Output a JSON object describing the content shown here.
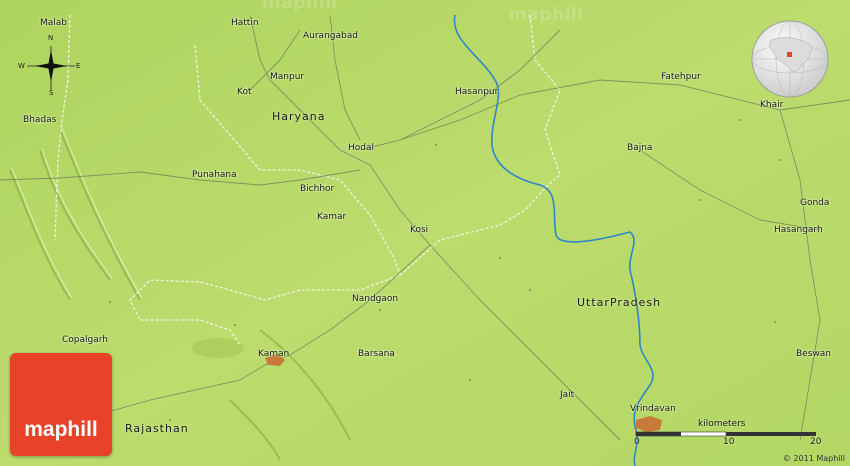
{
  "places": [
    {
      "name": "Malab"
    },
    {
      "name": "Hattin"
    },
    {
      "name": "Aurangabad"
    },
    {
      "name": "Manpur"
    },
    {
      "name": "Kot"
    },
    {
      "name": "Hasanpur"
    },
    {
      "name": "Fatehpur"
    },
    {
      "name": "Khair"
    },
    {
      "name": "Bhadas"
    },
    {
      "name": "Hodal"
    },
    {
      "name": "Bajna"
    },
    {
      "name": "Punahana"
    },
    {
      "name": "Bichhor"
    },
    {
      "name": "Kamar"
    },
    {
      "name": "Kosi"
    },
    {
      "name": "Gonda"
    },
    {
      "name": "Hasangarh"
    },
    {
      "name": "Nandgaon"
    },
    {
      "name": "Copalgarh"
    },
    {
      "name": "Kaman"
    },
    {
      "name": "Barsana"
    },
    {
      "name": "Beswan"
    },
    {
      "name": "Jait"
    },
    {
      "name": "Vrindavan"
    }
  ],
  "regions": {
    "haryana": "Haryana",
    "uttar_pradesh": "UttarPradesh",
    "rajasthan": "Rajasthan"
  },
  "compass": {
    "n": "N",
    "s": "S",
    "e": "E",
    "w": "W"
  },
  "scale": {
    "unit": "kilometers",
    "ticks": [
      "0",
      "10",
      "20"
    ]
  },
  "branding": {
    "logo": "maphill",
    "watermark": "maphill",
    "copyright": "© 2011 Maphill"
  },
  "colors": {
    "land": "#b8d96a",
    "river": "#2f86c8",
    "border": "#f2f7e6",
    "logo": "#e84229",
    "urban": "#c77a3a"
  }
}
